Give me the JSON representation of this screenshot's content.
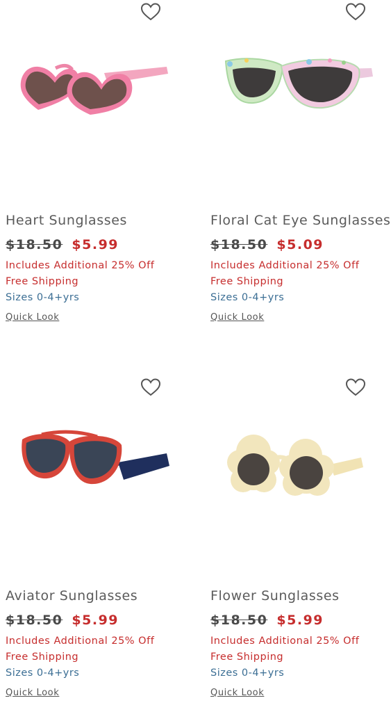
{
  "products": [
    {
      "name": "Heart Sunglasses",
      "original_price": "$18.50",
      "sale_price": "$5.99",
      "promo": "Includes Additional 25% Off",
      "shipping": "Free Shipping",
      "sizes": "Sizes 0-4+yrs",
      "quick_look": "Quick Look",
      "image_icon": "heart-sunglasses-image"
    },
    {
      "name": "Floral Cat Eye Sunglasses",
      "original_price": "$18.50",
      "sale_price": "$5.09",
      "promo": "Includes Additional 25% Off",
      "shipping": "Free Shipping",
      "sizes": "Sizes 0-4+yrs",
      "quick_look": "Quick Look",
      "image_icon": "floral-cat-eye-sunglasses-image"
    },
    {
      "name": "Aviator Sunglasses",
      "original_price": "$18.50",
      "sale_price": "$5.99",
      "promo": "Includes Additional 25% Off",
      "shipping": "Free Shipping",
      "sizes": "Sizes 0-4+yrs",
      "quick_look": "Quick Look",
      "image_icon": "aviator-sunglasses-image"
    },
    {
      "name": "Flower Sunglasses",
      "original_price": "$18.50",
      "sale_price": "$5.99",
      "promo": "Includes Additional 25% Off",
      "shipping": "Free Shipping",
      "sizes": "Sizes 0-4+yrs",
      "quick_look": "Quick Look",
      "image_icon": "flower-sunglasses-image"
    }
  ],
  "colors": {
    "sale_red": "#c62d2d",
    "sizes_blue": "#3b6e94",
    "text_gray": "#5b5b5b"
  }
}
